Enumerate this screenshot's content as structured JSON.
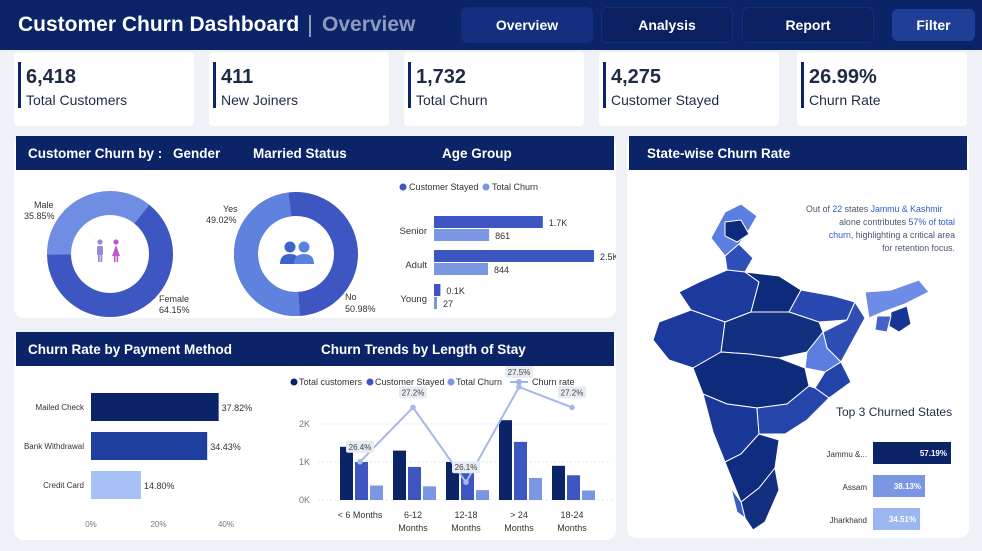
{
  "header": {
    "title": "Customer Churn Dashboard",
    "subtitle": "Overview",
    "nav": [
      "Overview",
      "Analysis",
      "Report"
    ],
    "filter": "Filter"
  },
  "kpis": [
    {
      "value": "6,418",
      "label": "Total Customers"
    },
    {
      "value": "411",
      "label": "New Joiners"
    },
    {
      "value": "1,732",
      "label": "Total Churn"
    },
    {
      "value": "4,275",
      "label": "Customer Stayed"
    },
    {
      "value": "26.99%",
      "label": "Churn Rate"
    }
  ],
  "demographics": {
    "header_prefix": "Customer Churn by :",
    "header_gender": "Gender",
    "header_married": "Married Status",
    "header_age": "Age Group",
    "gender": {
      "male_label": "Male",
      "male_pct": "35.85%",
      "female_label": "Female",
      "female_pct": "64.15%",
      "male_share": 0.3585
    },
    "married": {
      "yes_label": "Yes",
      "yes_pct": "49.02%",
      "no_label": "No",
      "no_pct": "50.98%",
      "yes_share": 0.4902
    },
    "age_legend": [
      "Customer Stayed",
      "Total Churn"
    ],
    "age_groups": [
      {
        "label": "Senior",
        "stayed": 1700,
        "stayed_label": "1.7K",
        "churn": 861,
        "churn_label": "861"
      },
      {
        "label": "Adult",
        "stayed": 2500,
        "stayed_label": "2.5K",
        "churn": 844,
        "churn_label": "844"
      },
      {
        "label": "Young",
        "stayed": 100,
        "stayed_label": "0.1K",
        "churn": 27,
        "churn_label": "27"
      }
    ]
  },
  "payment": {
    "header": "Churn Rate by  Payment Method",
    "items": [
      {
        "label": "Mailed Check",
        "value": 37.82,
        "value_label": "37.82%"
      },
      {
        "label": "Bank Withdrawal",
        "value": 34.43,
        "value_label": "34.43%"
      },
      {
        "label": "Credit Card",
        "value": 14.8,
        "value_label": "14.80%"
      }
    ],
    "ticks": [
      "0%",
      "20%",
      "40%"
    ]
  },
  "stay": {
    "header": "Churn Trends by Length of Stay",
    "legend": [
      "Total customers",
      "Customer Stayed",
      "Total Churn",
      "Churn rate"
    ],
    "yticks": [
      "0K",
      "1K",
      "2K"
    ],
    "groups": [
      {
        "label1": "< 6 Months",
        "label2": "",
        "total": 1400,
        "stayed": 1000,
        "churn": 380,
        "rate": 26.4,
        "rate_label": "26.4%"
      },
      {
        "label1": "6-12",
        "label2": "Months",
        "total": 1300,
        "stayed": 870,
        "churn": 360,
        "rate": 27.2,
        "rate_label": "27.2%"
      },
      {
        "label1": "12-18",
        "label2": "Months",
        "total": 1000,
        "stayed": 730,
        "churn": 260,
        "rate": 26.1,
        "rate_label": "26.1%"
      },
      {
        "label1": "> 24",
        "label2": "Months",
        "total": 2100,
        "stayed": 1530,
        "churn": 580,
        "rate": 27.5,
        "rate_label": "27.5%"
      },
      {
        "label1": "18-24",
        "label2": "Months",
        "total": 900,
        "stayed": 650,
        "churn": 250,
        "rate": 27.2,
        "rate_label": "27.2%"
      }
    ]
  },
  "state": {
    "header": "State-wise Churn Rate",
    "note": {
      "t1": "Out of ",
      "n1": "22",
      "t2": " states ",
      "s1": "Jammu & Kashmir",
      "t3": "alone contributes ",
      "s2": "57% of total",
      "s3": "churn",
      "t4": ", highlighting a critical area",
      "t5": "for retention focus."
    },
    "top3_title": "Top 3 Churned States",
    "top3": [
      {
        "label": "Jammu &...",
        "value": 57.19,
        "value_label": "57.19%"
      },
      {
        "label": "Assam",
        "value": 38.13,
        "value_label": "38.13%"
      },
      {
        "label": "Jharkhand",
        "value": 34.51,
        "value_label": "34.51%"
      }
    ]
  },
  "colors": {
    "navy": "#0b2468",
    "dark": "#1c2f8c",
    "mid": "#3d56c1",
    "light": "#7b97e3",
    "pale": "#a8c0f5"
  }
}
